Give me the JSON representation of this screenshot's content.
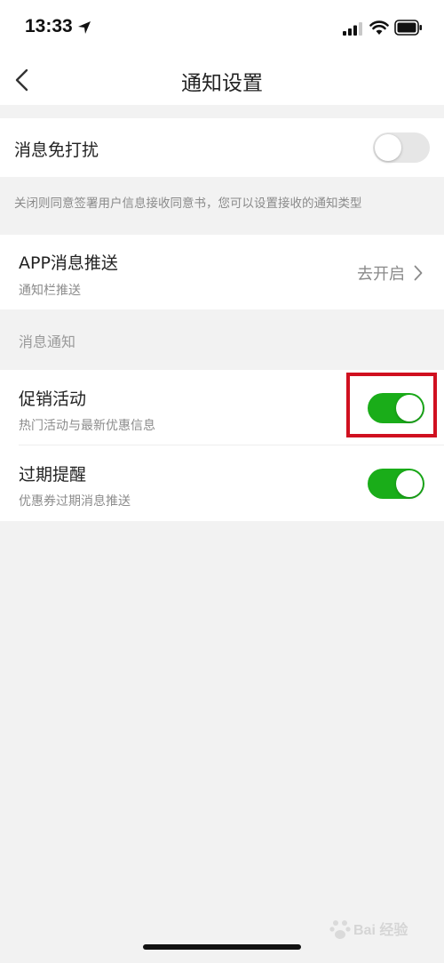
{
  "status": {
    "time": "13:33"
  },
  "nav": {
    "title": "通知设置"
  },
  "dnd": {
    "title": "消息免打扰",
    "enabled": false,
    "hint": "关闭则同意签署用户信息接收同意书，您可以设置接收的通知类型"
  },
  "push": {
    "title": "APP消息推送",
    "subtitle": "通知栏推送",
    "action": "去开启"
  },
  "notices": {
    "section_label": "消息通知",
    "items": [
      {
        "title": "促销活动",
        "subtitle": "热门活动与最新优惠信息",
        "enabled": true
      },
      {
        "title": "过期提醒",
        "subtitle": "优惠券过期消息推送",
        "enabled": true
      }
    ]
  },
  "watermark": {
    "text": "Bai 经验"
  },
  "colors": {
    "toggle_on": "#1aad19",
    "toggle_off": "#e6e6e6",
    "highlight": "#d01020",
    "background": "#f2f2f2"
  }
}
